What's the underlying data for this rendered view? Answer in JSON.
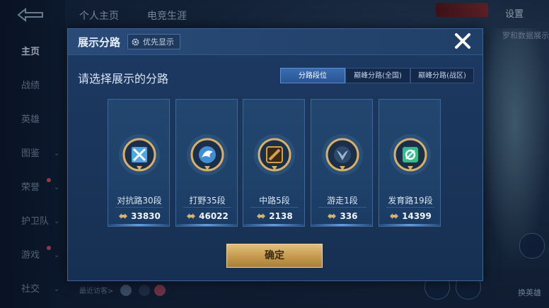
{
  "background": {
    "top_tabs": [
      "个人主页",
      "电竞生涯"
    ],
    "settings_label": "设置",
    "behind_text": "罗和数据展示",
    "nav_items": [
      {
        "label": "主页",
        "active": true,
        "chevron": false,
        "dot": false
      },
      {
        "label": "战绩",
        "active": false,
        "chevron": false,
        "dot": false
      },
      {
        "label": "英雄",
        "active": false,
        "chevron": false,
        "dot": false
      },
      {
        "label": "图鉴",
        "active": false,
        "chevron": true,
        "dot": false
      },
      {
        "label": "荣誉",
        "active": false,
        "chevron": true,
        "dot": true
      },
      {
        "label": "护卫队",
        "active": false,
        "chevron": true,
        "dot": false
      },
      {
        "label": "游戏",
        "active": false,
        "chevron": true,
        "dot": true
      },
      {
        "label": "社交",
        "active": false,
        "chevron": true,
        "dot": false
      }
    ],
    "recent_visitors_label": "最近访客>",
    "side_label": "换英雄"
  },
  "modal": {
    "title": "展示分路",
    "priority_label": "优先显示",
    "subtitle": "请选择展示的分路",
    "segments": [
      {
        "label": "分路段位",
        "active": true
      },
      {
        "label": "巅峰分路(全国)",
        "active": false
      },
      {
        "label": "巅峰分路(战区)",
        "active": false
      }
    ],
    "cards": [
      {
        "role": "对抗路30段",
        "score": "33830",
        "badge": "crossed-swords-badge-icon",
        "icon_color": "#4aa8e8"
      },
      {
        "role": "打野35段",
        "score": "46022",
        "badge": "dragon-badge-icon",
        "icon_color": "#3f8fd8"
      },
      {
        "role": "中路5段",
        "score": "2138",
        "badge": "slash-badge-icon",
        "icon_color": "#d6a04a"
      },
      {
        "role": "游走1段",
        "score": "336",
        "badge": "wings-badge-icon",
        "icon_color": "#9fb6cf"
      },
      {
        "role": "发育路19段",
        "score": "14399",
        "badge": "target-badge-icon",
        "icon_color": "#2fc08a"
      }
    ],
    "confirm_label": "确定"
  },
  "colors": {
    "accent_blue": "#3a6cb0",
    "gold": "#d8b26a",
    "modal_bg": "#1d3a63"
  }
}
